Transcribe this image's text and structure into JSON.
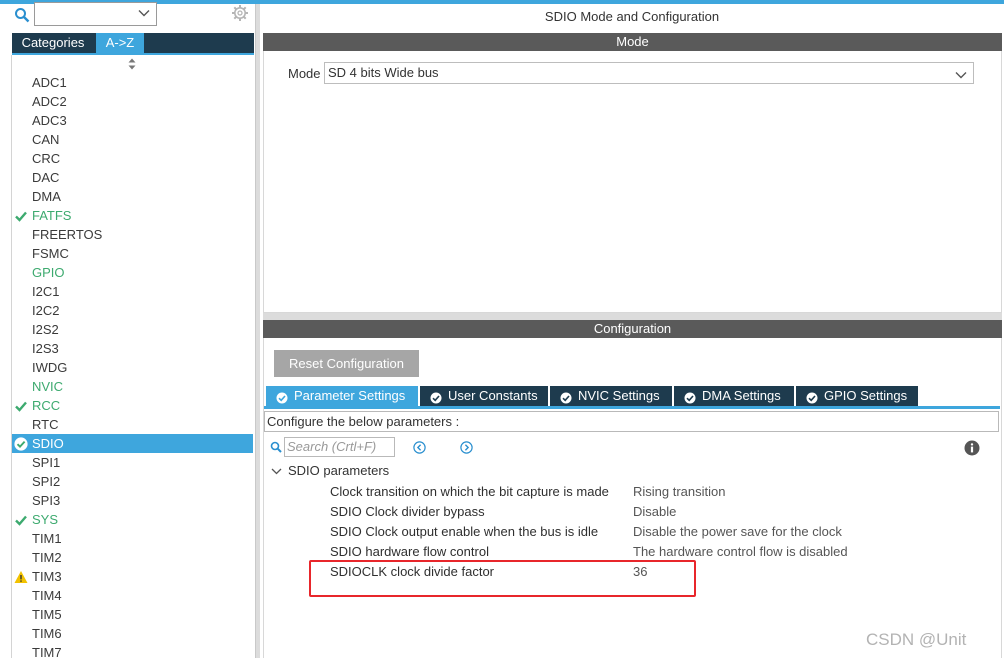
{
  "left_panel": {
    "tabs": [
      {
        "label": "Categories"
      },
      {
        "label": "A->Z"
      }
    ],
    "peripherals": [
      {
        "label": "ADC1",
        "status": "none"
      },
      {
        "label": "ADC2",
        "status": "none"
      },
      {
        "label": "ADC3",
        "status": "none"
      },
      {
        "label": "CAN",
        "status": "none"
      },
      {
        "label": "CRC",
        "status": "none"
      },
      {
        "label": "DAC",
        "status": "none"
      },
      {
        "label": "DMA",
        "status": "none"
      },
      {
        "label": "FATFS",
        "status": "check"
      },
      {
        "label": "FREERTOS",
        "status": "none"
      },
      {
        "label": "FSMC",
        "status": "none"
      },
      {
        "label": "GPIO",
        "status": "green"
      },
      {
        "label": "I2C1",
        "status": "none"
      },
      {
        "label": "I2C2",
        "status": "none"
      },
      {
        "label": "I2S2",
        "status": "none"
      },
      {
        "label": "I2S3",
        "status": "none"
      },
      {
        "label": "IWDG",
        "status": "none"
      },
      {
        "label": "NVIC",
        "status": "green"
      },
      {
        "label": "RCC",
        "status": "check"
      },
      {
        "label": "RTC",
        "status": "none"
      },
      {
        "label": "SDIO",
        "status": "selected"
      },
      {
        "label": "SPI1",
        "status": "none"
      },
      {
        "label": "SPI2",
        "status": "none"
      },
      {
        "label": "SPI3",
        "status": "none"
      },
      {
        "label": "SYS",
        "status": "check"
      },
      {
        "label": "TIM1",
        "status": "none"
      },
      {
        "label": "TIM2",
        "status": "none"
      },
      {
        "label": "TIM3",
        "status": "warning"
      },
      {
        "label": "TIM4",
        "status": "none"
      },
      {
        "label": "TIM5",
        "status": "none"
      },
      {
        "label": "TIM6",
        "status": "none"
      },
      {
        "label": "TIM7",
        "status": "none"
      }
    ]
  },
  "main": {
    "title": "SDIO Mode and Configuration",
    "mode_section": {
      "header": "Mode",
      "mode_label": "Mode",
      "mode_value": "SD 4 bits Wide bus"
    },
    "config_section": {
      "header": "Configuration",
      "reset_label": "Reset Configuration",
      "tabs": [
        {
          "label": "Parameter Settings",
          "active": true
        },
        {
          "label": "User Constants",
          "active": false
        },
        {
          "label": "NVIC Settings",
          "active": false
        },
        {
          "label": "DMA Settings",
          "active": false
        },
        {
          "label": "GPIO Settings",
          "active": false
        }
      ],
      "instruction": "Configure the below parameters :",
      "search_placeholder": "Search (Crtl+F)",
      "group_label": "SDIO parameters",
      "params": [
        {
          "name": "Clock transition on which the bit capture is made",
          "value": "Rising transition"
        },
        {
          "name": "SDIO Clock divider bypass",
          "value": "Disable"
        },
        {
          "name": "SDIO Clock output enable when the bus is idle",
          "value": "Disable the power save for the clock"
        },
        {
          "name": "SDIO hardware flow control",
          "value": "The hardware control flow is disabled"
        },
        {
          "name": "SDIOCLK clock divide factor",
          "value": "36"
        }
      ]
    }
  },
  "watermark": "CSDN @Unit",
  "colors": {
    "accent": "#3ea6dd",
    "dark_tab": "#1e3b4e",
    "section_header": "#5a5a5a",
    "ok_green": "#3daa6f",
    "warning": "#f2c200",
    "highlight": "#e8262b"
  },
  "icons": {
    "search": "search-icon",
    "gear": "gear-icon",
    "sort": "sort-arrows-icon",
    "check": "check-icon",
    "warning": "warning-icon",
    "info": "info-icon"
  }
}
